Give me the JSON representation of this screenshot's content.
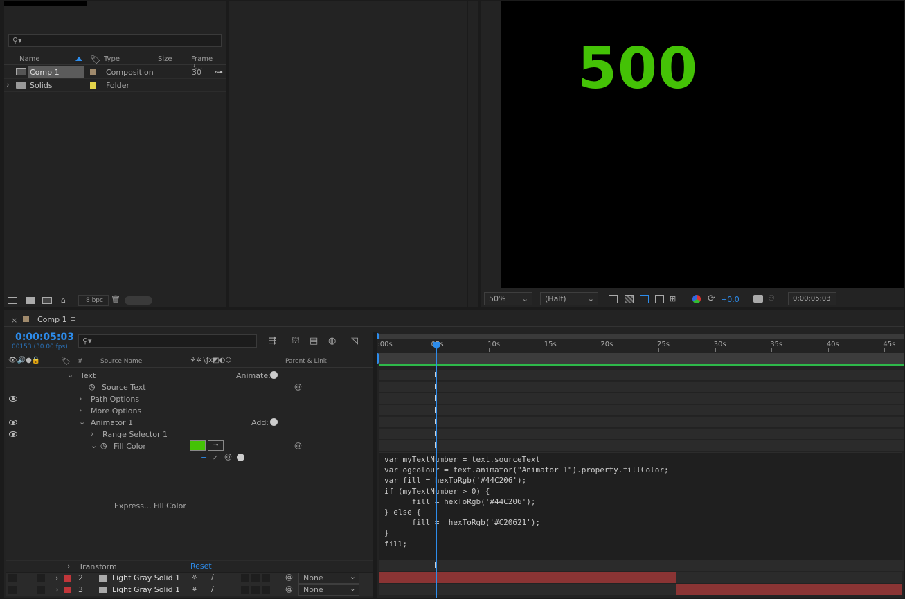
{
  "project": {
    "search_placeholder": "",
    "columns": {
      "name": "Name",
      "type": "Type",
      "size": "Size",
      "frame_rate": "Frame R..."
    },
    "items": [
      {
        "name": "Comp 1",
        "label_color": "#a08a6c",
        "type": "Composition",
        "size": "",
        "frame_rate": "30"
      },
      {
        "name": "Solids",
        "label_color": "#e2d34a",
        "type": "Folder",
        "size": "",
        "frame_rate": ""
      }
    ],
    "bpc": "8 bpc"
  },
  "viewer": {
    "display_text": "500",
    "display_color": "#44C206",
    "zoom": "50%",
    "resolution": "(Half)",
    "exposure": "+0.0",
    "timecode": "0:00:05:03"
  },
  "timeline": {
    "tab_name": "Comp 1",
    "current_time": "0:00:05:03",
    "frame_info": "00153 (30.00 fps)",
    "columns": {
      "num": "#",
      "source_name": "Source Name",
      "parent": "Parent & Link"
    },
    "ruler": [
      "0:00s",
      "05s",
      "10s",
      "15s",
      "20s",
      "25s",
      "30s",
      "35s",
      "40s",
      "45s"
    ],
    "properties": {
      "text": "Text",
      "animate": "Animate:",
      "source_text": "Source Text",
      "path_options": "Path Options",
      "more_options": "More Options",
      "animator": "Animator 1",
      "add": "Add:",
      "range_selector": "Range Selector 1",
      "fill_color": "Fill Color",
      "fill_swatch": "#44C206",
      "expression_label": "Express... Fill Color",
      "transform": "Transform",
      "reset": "Reset"
    },
    "expression_lines": [
      "var myTextNumber = text.sourceText",
      "var ogcolour = text.animator(\"Animator 1\").property.fillColor;",
      "var fill = hexToRgb('#44C206');",
      "if (myTextNumber > 0) {",
      "      fill = hexToRgb('#44C206');",
      "} else {",
      "      fill =  hexToRgb('#C20621');",
      "}",
      "fill;"
    ],
    "layers": [
      {
        "num": "2",
        "name": "Light Gray Solid 1",
        "label_color": "#c0363a",
        "parent": "None"
      },
      {
        "num": "3",
        "name": "Light Gray Solid 1",
        "label_color": "#c0363a",
        "parent": "None"
      }
    ],
    "bar_color": "#8a3434"
  }
}
